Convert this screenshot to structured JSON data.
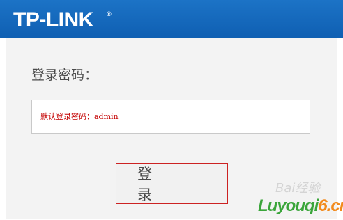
{
  "header": {
    "logo": "TP-LINK",
    "logo_reg": "®"
  },
  "login": {
    "label": "登录密码：",
    "password_hint": "默认登录密码：admin",
    "button_label": "登 录"
  },
  "watermark": {
    "baidu": "Bai经验",
    "site_part1": "Luyouqi",
    "site_part2": "6.cn"
  }
}
